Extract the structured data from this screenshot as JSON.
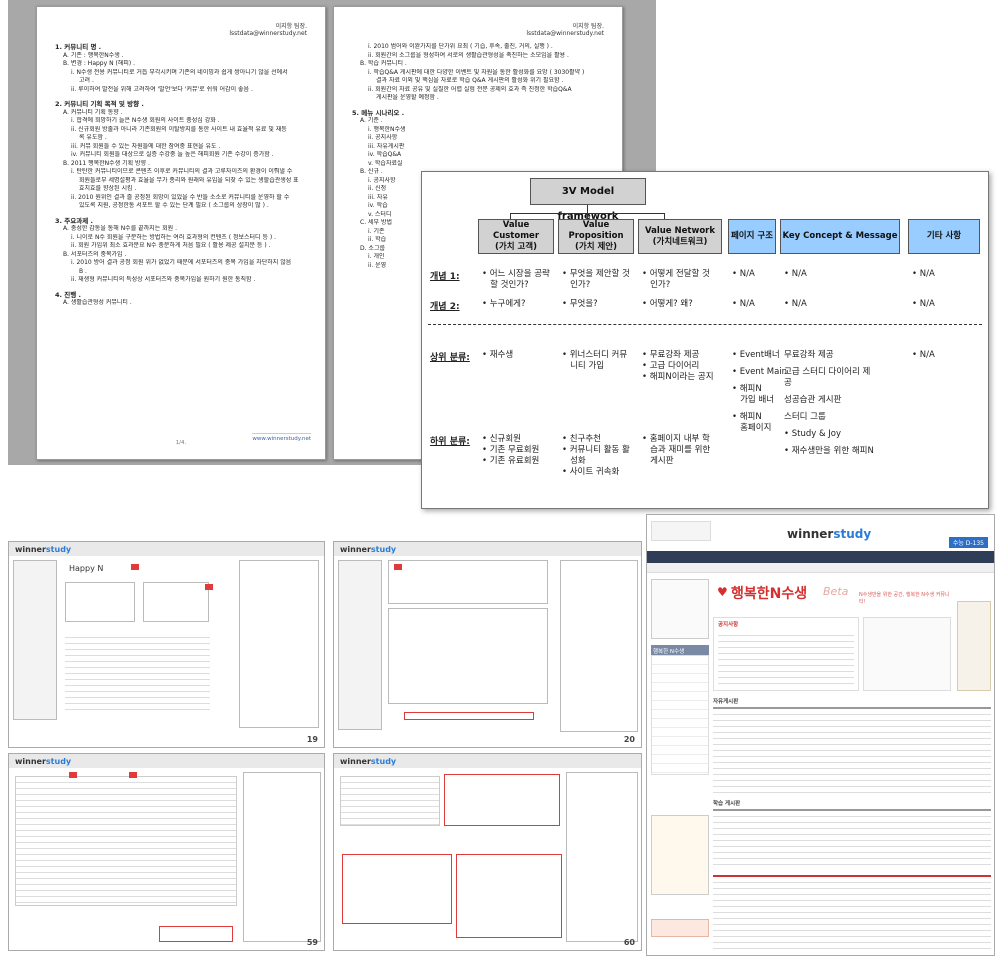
{
  "doc1": {
    "header_name": "이지항 팀장.",
    "header_email": "lsstdata@winnerstudy.net",
    "lines": [
      {
        "cls": "sec",
        "t": "1.  커뮤니티 명 ."
      },
      {
        "cls": "i1",
        "t": "A.  기존 : 행복한N수생 ."
      },
      {
        "cls": "i1",
        "t": "B.  변경 : Happy N (해피) ."
      },
      {
        "cls": "i2",
        "t": "i.   N수생 전용 커뮤니티로 거듭 부각시키며 기존의 네이밍과 쉽게 쌍아니기 않을 선에서"
      },
      {
        "cls": "i3",
        "t": "고려 ."
      },
      {
        "cls": "i2",
        "t": "ii.  루이하여 발전을 위해 고려하여 '발언'보다 '커뮤'로 쉬워 어감이 좋음 ."
      },
      {
        "cls": "sec",
        "t": "2.  커뮤니티 기획 목적 및 방향 ."
      },
      {
        "cls": "i1",
        "t": "A.  커뮤니티 기획 동향 ."
      },
      {
        "cls": "i2",
        "t": "i.   합격에 희망하기 늘은 N수생 회원의 사이트 충성심 강화 ."
      },
      {
        "cls": "i2",
        "t": "ii.  신규회원 방출과 아니라 기존회원의 이탈방지를 통한 사이트 내 효율적 유료 및 재등"
      },
      {
        "cls": "i3",
        "t": "록 유도함 ."
      },
      {
        "cls": "i2",
        "t": "iii. 커뮤 회원들 수 있는 자원들에 대한 참여중 표현을 유도 ."
      },
      {
        "cls": "i2",
        "t": "iv.  커뮤니티 회원들 대상으로 실증 수강중 늘 높은 해피회원 기존 수강이 증가함 ."
      },
      {
        "cls": "i1",
        "t": "B.  2011 행복한N수생 기획 방향 ."
      },
      {
        "cls": "i2",
        "t": "i.   탄탄한 커뮤니티이므로 콘텐츠 이후로 커뮤니티의 결과 고루자이즈의 환경이 이뤄낼 수"
      },
      {
        "cls": "i3",
        "t": "회원들로부 세명설평과 효율을 무가 종리와 원래와 유입을 되찾 수 있는 생할습관생성 표"
      },
      {
        "cls": "i3",
        "t": "효치효를 향상된 시킴 ."
      },
      {
        "cls": "i2",
        "t": "ii.  2010 원위인 결과 즐 공정된 회망이 있었을 수 반들 소소로 커뮤니티를 운영하 할 수"
      },
      {
        "cls": "i3",
        "t": "있도록 지원, 공정한통 서포트 할 수 있는 단계 필요 ( 소그룹의 상장이 많 ) ."
      },
      {
        "cls": "sec",
        "t": "3.  주요과제 ."
      },
      {
        "cls": "i1",
        "t": "A.  충성한 감동을 통해 N수를 끝까지는 회원 ."
      },
      {
        "cls": "i2",
        "t": "i.   니이로 N수 회원을 구분하는 방법하는 여러 효과형의 컨텐츠 ( 정보스터디 등 ) ."
      },
      {
        "cls": "i2",
        "t": "ii.  회원 가입위 최소 효과분요 N수 충분하게 처음 필요 ( 활용 제공 설치분 등 ) ."
      },
      {
        "cls": "i1",
        "t": "B.  서포터즈의 중복가입 ."
      },
      {
        "cls": "i2",
        "t": "i.   2010 방어 결과 공정 회원 위가 없었기 때문에 서포터즈의 중복 가입을 차단하지 않음"
      },
      {
        "cls": "i3",
        "t": "B ."
      },
      {
        "cls": "i2",
        "t": "ii.  재생형 커뮤니티의 특성상 서포터즈와 중복가입을 원하기 원한 통칙함 ."
      },
      {
        "cls": "sec",
        "t": "4.  진행 ."
      },
      {
        "cls": "i1",
        "t": "A.  생활습관형성 커뮤니티 ."
      }
    ],
    "page_footer": "1/4.",
    "footer_url": "www.winnerstudy.net"
  },
  "doc2": {
    "header_name": "이지항 팀장.",
    "header_email": "lsstdata@winnerstudy.net",
    "lines": [
      {
        "cls": "i2",
        "t": "i.   2010 범어와 이완가지를 단가위 요최 ( 기습, 후속, 출진, 거의, 실행 ) ."
      },
      {
        "cls": "i2",
        "t": "ii.  회원간의 소그룹을 형성하여 서로의 생활습관형성을 촉진하는 소모임을 활용 ."
      },
      {
        "cls": "i1",
        "t": "B.  학습 커뮤니티 ."
      },
      {
        "cls": "i2",
        "t": "i.   학습Q&A 게시판에 대한 다양한 이벤트 및 자원을 통한 활성화를 요망 ( 3030활약 )"
      },
      {
        "cls": "i3",
        "t": "결과 자료 이외 및 핵심을 자료로 학습 Q&A 게시판의 활성화 위기 필요함 ."
      },
      {
        "cls": "i2",
        "t": "ii.  회원간의 자료 공유 및 실질한 어렵 실험 전문 공제의 효과 즉 진정한 학습Q&A"
      },
      {
        "cls": "i3",
        "t": "게시판을 운영할 예정함 ."
      },
      {
        "cls": "sec",
        "t": "5.  메뉴 시나리오 ."
      },
      {
        "cls": "i1",
        "t": "A.  기준 ."
      },
      {
        "cls": "i2",
        "t": "i.   행복한N수생"
      },
      {
        "cls": "i2",
        "t": "ii.  공지사항"
      },
      {
        "cls": "i2",
        "t": "iii. 자유게시판"
      },
      {
        "cls": "i2",
        "t": "iv.  학습Q&A"
      },
      {
        "cls": "i2",
        "t": "v.   학습자료실"
      },
      {
        "cls": "i1",
        "t": "B.  신규 ."
      },
      {
        "cls": "i2",
        "t": "i.   공지사항"
      },
      {
        "cls": "i2",
        "t": "ii.  신청"
      },
      {
        "cls": "i2",
        "t": "iii. 자유"
      },
      {
        "cls": "i2",
        "t": "iv.  학습"
      },
      {
        "cls": "i2",
        "t": "v.   스터디"
      },
      {
        "cls": "i1",
        "t": "C.  세부 방법"
      },
      {
        "cls": "i2",
        "t": "i.   기존"
      },
      {
        "cls": "i2",
        "t": "ii.  학습"
      },
      {
        "cls": "i1",
        "t": "D.  소그룹"
      },
      {
        "cls": "i2",
        "t": "i.   개인"
      },
      {
        "cls": "i2",
        "t": "ii.  운영"
      }
    ]
  },
  "framework": {
    "title": "3V Model framework",
    "headers": [
      {
        "l1": "Value Customer",
        "l2": "(가치 고객)"
      },
      {
        "l1": "Value Proposition",
        "l2": "(가치 제안)"
      },
      {
        "l1": "Value Network",
        "l2": "(가치네트워크)"
      },
      {
        "l1": "페이지 구조",
        "l2": ""
      },
      {
        "l1": "Key Concept & Message",
        "l2": ""
      },
      {
        "l1": "기타 사항",
        "l2": ""
      }
    ],
    "row_labels": [
      "개념 1:",
      "개념 2:",
      "상위 분류:",
      "하위 분류:"
    ],
    "rows": [
      [
        [
          "• 어느 시장을 공략",
          "   할 것인가?"
        ],
        [
          "• 무엇을 제안할 것",
          "   인가?"
        ],
        [
          "• 어떻게 전달할 것",
          "   인가?"
        ],
        [
          "• N/A"
        ],
        [
          "• N/A"
        ],
        [
          "• N/A"
        ]
      ],
      [
        [
          "• 누구에게?"
        ],
        [
          "• 무엇을?"
        ],
        [
          "• 어떻게? 왜?"
        ],
        [
          "• N/A"
        ],
        [
          "• N/A"
        ],
        [
          "• N/A"
        ]
      ],
      [
        [
          "• 재수생"
        ],
        [
          "• 위너스터디 커뮤",
          "   니티 가입"
        ],
        [
          "• 무료강좌 제공",
          "• 고급 다이어리",
          "• 해피N이라는 공지"
        ],
        [
          "• Event배너",
          "",
          "• Event Main",
          "",
          "• 해피N",
          "   가입 배너",
          "",
          "• 해피N",
          "   홈페이지"
        ],
        [
          "무료강좌 제공",
          "",
          "고급 스터디 다이어리 제",
          "공",
          "",
          "성공습관 게시판",
          "",
          "스터디 그룹",
          "",
          "• Study & Joy",
          "",
          "• 재수생만을 위한 해피N"
        ],
        [
          "• N/A"
        ]
      ],
      [
        [
          "• 신규회원",
          "• 기존 무료회원",
          "• 기존 유료회원"
        ],
        [
          "• 친구추천",
          "• 커뮤니티 활동 활",
          "   성화",
          "• 사이트 귀속화"
        ],
        [
          "• 홈페이지 내부 학",
          "   습과 재미를 위한",
          "   게시판"
        ],
        [],
        [],
        []
      ]
    ]
  },
  "wire": {
    "logo_a": "winner",
    "logo_b": "study",
    "happy_title": "Happy N",
    "page_numbers": [
      "19",
      "20",
      "59",
      "60"
    ]
  },
  "website": {
    "logo_a": "winner",
    "logo_b": "study",
    "dday": "수능 D-135",
    "banner_title": "행복한N수생",
    "banner_script": "Beta",
    "banner_sub": "N수생만을 위한 공간, 행복한 N수생 커뮤니티!",
    "notice_title": "공지사항",
    "free_board": "자유게시판",
    "qa_board": "학습 게시판",
    "side_title": "행복한 N수생"
  }
}
